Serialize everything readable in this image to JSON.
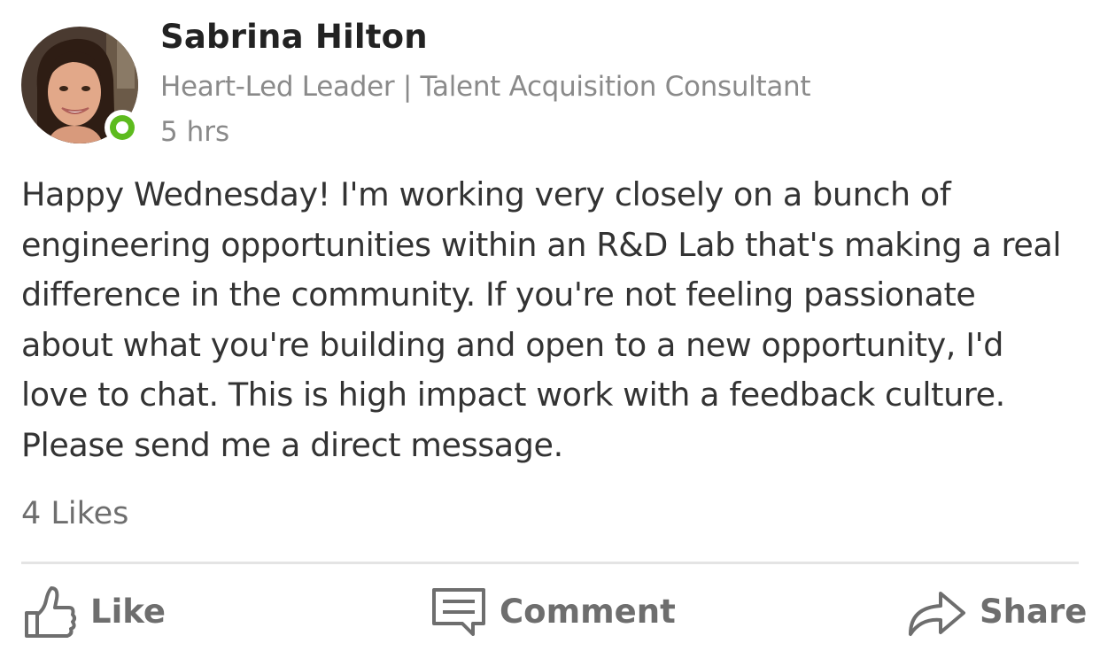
{
  "post": {
    "author": {
      "name": "Sabrina Hilton",
      "headline": "Heart-Led Leader | Talent Acquisition Consultant",
      "presence_color": "#5dbb1e"
    },
    "timestamp": "5 hrs",
    "body": "Happy Wednesday! I'm working very closely on a bunch of engineering opportunities within an R&D Lab that's making a real difference in the community. If you're not feeling passionate about what you're building and open to a new opportunity, I'd love to chat. This is high impact work with a feedback culture. Please send me a direct message.",
    "likes_text": "4 Likes"
  },
  "actions": {
    "like": {
      "label": "Like",
      "icon": "thumbs-up-icon"
    },
    "comment": {
      "label": "Comment",
      "icon": "comment-icon"
    },
    "share": {
      "label": "Share",
      "icon": "share-arrow-icon"
    }
  }
}
